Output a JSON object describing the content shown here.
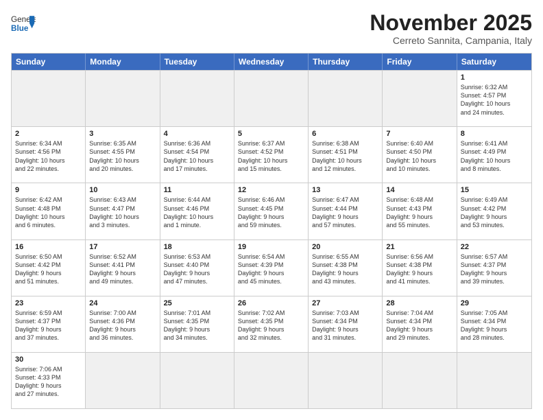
{
  "header": {
    "logo_general": "General",
    "logo_blue": "Blue",
    "month_title": "November 2025",
    "subtitle": "Cerreto Sannita, Campania, Italy"
  },
  "weekdays": [
    "Sunday",
    "Monday",
    "Tuesday",
    "Wednesday",
    "Thursday",
    "Friday",
    "Saturday"
  ],
  "rows": [
    [
      {
        "day": "",
        "info": "",
        "empty": true
      },
      {
        "day": "",
        "info": "",
        "empty": true
      },
      {
        "day": "",
        "info": "",
        "empty": true
      },
      {
        "day": "",
        "info": "",
        "empty": true
      },
      {
        "day": "",
        "info": "",
        "empty": true
      },
      {
        "day": "",
        "info": "",
        "empty": true
      },
      {
        "day": "1",
        "info": "Sunrise: 6:32 AM\nSunset: 4:57 PM\nDaylight: 10 hours\nand 24 minutes.",
        "empty": false
      }
    ],
    [
      {
        "day": "2",
        "info": "Sunrise: 6:34 AM\nSunset: 4:56 PM\nDaylight: 10 hours\nand 22 minutes.",
        "empty": false
      },
      {
        "day": "3",
        "info": "Sunrise: 6:35 AM\nSunset: 4:55 PM\nDaylight: 10 hours\nand 20 minutes.",
        "empty": false
      },
      {
        "day": "4",
        "info": "Sunrise: 6:36 AM\nSunset: 4:54 PM\nDaylight: 10 hours\nand 17 minutes.",
        "empty": false
      },
      {
        "day": "5",
        "info": "Sunrise: 6:37 AM\nSunset: 4:52 PM\nDaylight: 10 hours\nand 15 minutes.",
        "empty": false
      },
      {
        "day": "6",
        "info": "Sunrise: 6:38 AM\nSunset: 4:51 PM\nDaylight: 10 hours\nand 12 minutes.",
        "empty": false
      },
      {
        "day": "7",
        "info": "Sunrise: 6:40 AM\nSunset: 4:50 PM\nDaylight: 10 hours\nand 10 minutes.",
        "empty": false
      },
      {
        "day": "8",
        "info": "Sunrise: 6:41 AM\nSunset: 4:49 PM\nDaylight: 10 hours\nand 8 minutes.",
        "empty": false
      }
    ],
    [
      {
        "day": "9",
        "info": "Sunrise: 6:42 AM\nSunset: 4:48 PM\nDaylight: 10 hours\nand 6 minutes.",
        "empty": false
      },
      {
        "day": "10",
        "info": "Sunrise: 6:43 AM\nSunset: 4:47 PM\nDaylight: 10 hours\nand 3 minutes.",
        "empty": false
      },
      {
        "day": "11",
        "info": "Sunrise: 6:44 AM\nSunset: 4:46 PM\nDaylight: 10 hours\nand 1 minute.",
        "empty": false
      },
      {
        "day": "12",
        "info": "Sunrise: 6:46 AM\nSunset: 4:45 PM\nDaylight: 9 hours\nand 59 minutes.",
        "empty": false
      },
      {
        "day": "13",
        "info": "Sunrise: 6:47 AM\nSunset: 4:44 PM\nDaylight: 9 hours\nand 57 minutes.",
        "empty": false
      },
      {
        "day": "14",
        "info": "Sunrise: 6:48 AM\nSunset: 4:43 PM\nDaylight: 9 hours\nand 55 minutes.",
        "empty": false
      },
      {
        "day": "15",
        "info": "Sunrise: 6:49 AM\nSunset: 4:42 PM\nDaylight: 9 hours\nand 53 minutes.",
        "empty": false
      }
    ],
    [
      {
        "day": "16",
        "info": "Sunrise: 6:50 AM\nSunset: 4:42 PM\nDaylight: 9 hours\nand 51 minutes.",
        "empty": false
      },
      {
        "day": "17",
        "info": "Sunrise: 6:52 AM\nSunset: 4:41 PM\nDaylight: 9 hours\nand 49 minutes.",
        "empty": false
      },
      {
        "day": "18",
        "info": "Sunrise: 6:53 AM\nSunset: 4:40 PM\nDaylight: 9 hours\nand 47 minutes.",
        "empty": false
      },
      {
        "day": "19",
        "info": "Sunrise: 6:54 AM\nSunset: 4:39 PM\nDaylight: 9 hours\nand 45 minutes.",
        "empty": false
      },
      {
        "day": "20",
        "info": "Sunrise: 6:55 AM\nSunset: 4:38 PM\nDaylight: 9 hours\nand 43 minutes.",
        "empty": false
      },
      {
        "day": "21",
        "info": "Sunrise: 6:56 AM\nSunset: 4:38 PM\nDaylight: 9 hours\nand 41 minutes.",
        "empty": false
      },
      {
        "day": "22",
        "info": "Sunrise: 6:57 AM\nSunset: 4:37 PM\nDaylight: 9 hours\nand 39 minutes.",
        "empty": false
      }
    ],
    [
      {
        "day": "23",
        "info": "Sunrise: 6:59 AM\nSunset: 4:37 PM\nDaylight: 9 hours\nand 37 minutes.",
        "empty": false
      },
      {
        "day": "24",
        "info": "Sunrise: 7:00 AM\nSunset: 4:36 PM\nDaylight: 9 hours\nand 36 minutes.",
        "empty": false
      },
      {
        "day": "25",
        "info": "Sunrise: 7:01 AM\nSunset: 4:35 PM\nDaylight: 9 hours\nand 34 minutes.",
        "empty": false
      },
      {
        "day": "26",
        "info": "Sunrise: 7:02 AM\nSunset: 4:35 PM\nDaylight: 9 hours\nand 32 minutes.",
        "empty": false
      },
      {
        "day": "27",
        "info": "Sunrise: 7:03 AM\nSunset: 4:34 PM\nDaylight: 9 hours\nand 31 minutes.",
        "empty": false
      },
      {
        "day": "28",
        "info": "Sunrise: 7:04 AM\nSunset: 4:34 PM\nDaylight: 9 hours\nand 29 minutes.",
        "empty": false
      },
      {
        "day": "29",
        "info": "Sunrise: 7:05 AM\nSunset: 4:34 PM\nDaylight: 9 hours\nand 28 minutes.",
        "empty": false
      }
    ],
    [
      {
        "day": "30",
        "info": "Sunrise: 7:06 AM\nSunset: 4:33 PM\nDaylight: 9 hours\nand 27 minutes.",
        "empty": false
      },
      {
        "day": "",
        "info": "",
        "empty": true
      },
      {
        "day": "",
        "info": "",
        "empty": true
      },
      {
        "day": "",
        "info": "",
        "empty": true
      },
      {
        "day": "",
        "info": "",
        "empty": true
      },
      {
        "day": "",
        "info": "",
        "empty": true
      },
      {
        "day": "",
        "info": "",
        "empty": true
      }
    ]
  ]
}
